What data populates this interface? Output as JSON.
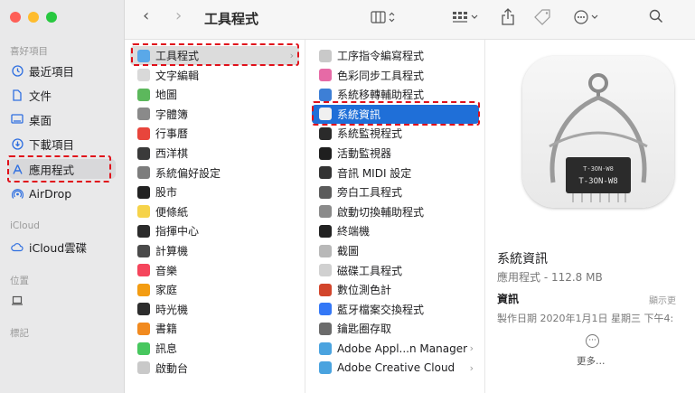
{
  "window": {
    "title": "工具程式",
    "traffic_colors": [
      "#fe5f57",
      "#febc2e",
      "#28c840"
    ]
  },
  "sidebar": {
    "favorites_title": "喜好項目",
    "favorites": [
      {
        "label": "最近項目",
        "icon": "clock-icon"
      },
      {
        "label": "文件",
        "icon": "document-icon"
      },
      {
        "label": "桌面",
        "icon": "desktop-icon"
      },
      {
        "label": "下載項目",
        "icon": "download-icon"
      },
      {
        "label": "應用程式",
        "icon": "applications-icon",
        "selected": true
      },
      {
        "label": "AirDrop",
        "icon": "airdrop-icon"
      }
    ],
    "icloud_title": "iCloud",
    "icloud_items": [
      {
        "label": "iCloud雲碟",
        "icon": "cloud-icon"
      }
    ],
    "locations_title": "位置",
    "locations_items": [
      {
        "label": "",
        "icon": "laptop-icon"
      }
    ],
    "tags_title": "標記"
  },
  "toolbar": {
    "back": "‹",
    "forward": "›",
    "view_icon": "columns-view-icon",
    "group_icon": "group-icon",
    "share_icon": "share-icon",
    "tag_icon": "tag-icon",
    "action_icon": "more-actions-icon",
    "search_icon": "search-icon"
  },
  "column1": [
    {
      "label": "工具程式",
      "color": "#5aa8e8",
      "has_chevron": true,
      "selected": true
    },
    {
      "label": "文字編輯",
      "color": "#d9d9d9"
    },
    {
      "label": "地圖",
      "color": "#5cb85c"
    },
    {
      "label": "字體簿",
      "color": "#8a8a8a"
    },
    {
      "label": "行事曆",
      "color": "#e8453c"
    },
    {
      "label": "西洋棋",
      "color": "#3a3a3a"
    },
    {
      "label": "系統偏好設定",
      "color": "#7d7d7d"
    },
    {
      "label": "股市",
      "color": "#222222"
    },
    {
      "label": "便條紙",
      "color": "#f6d34a"
    },
    {
      "label": "指揮中心",
      "color": "#2b2b2b"
    },
    {
      "label": "計算機",
      "color": "#4a4a4a"
    },
    {
      "label": "音樂",
      "color": "#f5455c"
    },
    {
      "label": "家庭",
      "color": "#f39c12"
    },
    {
      "label": "時光機",
      "color": "#2d2d2d"
    },
    {
      "label": "書籍",
      "color": "#f18a1f"
    },
    {
      "label": "訊息",
      "color": "#47c75e"
    },
    {
      "label": "啟動台",
      "color": "#c9c9c9"
    }
  ],
  "column2": [
    {
      "label": "工序指令編寫程式",
      "color": "#c9c9c9"
    },
    {
      "label": "色彩同步工具程式",
      "color": "#e66aa6"
    },
    {
      "label": "系統移轉輔助程式",
      "color": "#3d7fd6"
    },
    {
      "label": "系統資訊",
      "color": "#f0f0f0",
      "selected": true
    },
    {
      "label": "系統監視程式",
      "color": "#2a2a2a"
    },
    {
      "label": "活動監視器",
      "color": "#1f1f1f"
    },
    {
      "label": "音訊 MIDI 設定",
      "color": "#333333"
    },
    {
      "label": "旁白工具程式",
      "color": "#5b5b5b"
    },
    {
      "label": "啟動切換輔助程式",
      "color": "#8a8a8a"
    },
    {
      "label": "終端機",
      "color": "#222222"
    },
    {
      "label": "截圖",
      "color": "#b8b8b8"
    },
    {
      "label": "磁碟工具程式",
      "color": "#d0d0d0"
    },
    {
      "label": "數位測色計",
      "color": "#d2452b"
    },
    {
      "label": "藍牙檔案交換程式",
      "color": "#3478f6"
    },
    {
      "label": "鑰匙圈存取",
      "color": "#6b6b6b"
    },
    {
      "label": "Adobe Appl...n Manager",
      "color": "#4aa3df",
      "has_chevron": true
    },
    {
      "label": "Adobe Creative Cloud",
      "color": "#4aa3df",
      "has_chevron": true
    }
  ],
  "preview": {
    "name": "系統資訊",
    "kind": "應用程式 - 112.8 MB",
    "info_title": "資訊",
    "show_more": "顯示更",
    "created": "製作日期   2020年1月1日 星期三 下午4:",
    "more_label": "更多…",
    "icon_label_top": "T-3ON-W8",
    "icon_label_bottom": "T-3ON-W8"
  }
}
